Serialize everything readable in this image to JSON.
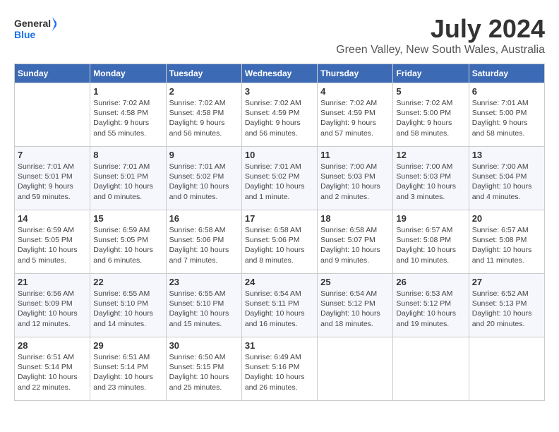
{
  "header": {
    "logo_line1": "General",
    "logo_line2": "Blue",
    "month_year": "July 2024",
    "location": "Green Valley, New South Wales, Australia"
  },
  "weekdays": [
    "Sunday",
    "Monday",
    "Tuesday",
    "Wednesday",
    "Thursday",
    "Friday",
    "Saturday"
  ],
  "weeks": [
    [
      {
        "day": "",
        "sunrise": "",
        "sunset": "",
        "daylight": ""
      },
      {
        "day": "1",
        "sunrise": "Sunrise: 7:02 AM",
        "sunset": "Sunset: 4:58 PM",
        "daylight": "Daylight: 9 hours and 55 minutes."
      },
      {
        "day": "2",
        "sunrise": "Sunrise: 7:02 AM",
        "sunset": "Sunset: 4:58 PM",
        "daylight": "Daylight: 9 hours and 56 minutes."
      },
      {
        "day": "3",
        "sunrise": "Sunrise: 7:02 AM",
        "sunset": "Sunset: 4:59 PM",
        "daylight": "Daylight: 9 hours and 56 minutes."
      },
      {
        "day": "4",
        "sunrise": "Sunrise: 7:02 AM",
        "sunset": "Sunset: 4:59 PM",
        "daylight": "Daylight: 9 hours and 57 minutes."
      },
      {
        "day": "5",
        "sunrise": "Sunrise: 7:02 AM",
        "sunset": "Sunset: 5:00 PM",
        "daylight": "Daylight: 9 hours and 58 minutes."
      },
      {
        "day": "6",
        "sunrise": "Sunrise: 7:01 AM",
        "sunset": "Sunset: 5:00 PM",
        "daylight": "Daylight: 9 hours and 58 minutes."
      }
    ],
    [
      {
        "day": "7",
        "sunrise": "Sunrise: 7:01 AM",
        "sunset": "Sunset: 5:01 PM",
        "daylight": "Daylight: 9 hours and 59 minutes."
      },
      {
        "day": "8",
        "sunrise": "Sunrise: 7:01 AM",
        "sunset": "Sunset: 5:01 PM",
        "daylight": "Daylight: 10 hours and 0 minutes."
      },
      {
        "day": "9",
        "sunrise": "Sunrise: 7:01 AM",
        "sunset": "Sunset: 5:02 PM",
        "daylight": "Daylight: 10 hours and 0 minutes."
      },
      {
        "day": "10",
        "sunrise": "Sunrise: 7:01 AM",
        "sunset": "Sunset: 5:02 PM",
        "daylight": "Daylight: 10 hours and 1 minute."
      },
      {
        "day": "11",
        "sunrise": "Sunrise: 7:00 AM",
        "sunset": "Sunset: 5:03 PM",
        "daylight": "Daylight: 10 hours and 2 minutes."
      },
      {
        "day": "12",
        "sunrise": "Sunrise: 7:00 AM",
        "sunset": "Sunset: 5:03 PM",
        "daylight": "Daylight: 10 hours and 3 minutes."
      },
      {
        "day": "13",
        "sunrise": "Sunrise: 7:00 AM",
        "sunset": "Sunset: 5:04 PM",
        "daylight": "Daylight: 10 hours and 4 minutes."
      }
    ],
    [
      {
        "day": "14",
        "sunrise": "Sunrise: 6:59 AM",
        "sunset": "Sunset: 5:05 PM",
        "daylight": "Daylight: 10 hours and 5 minutes."
      },
      {
        "day": "15",
        "sunrise": "Sunrise: 6:59 AM",
        "sunset": "Sunset: 5:05 PM",
        "daylight": "Daylight: 10 hours and 6 minutes."
      },
      {
        "day": "16",
        "sunrise": "Sunrise: 6:58 AM",
        "sunset": "Sunset: 5:06 PM",
        "daylight": "Daylight: 10 hours and 7 minutes."
      },
      {
        "day": "17",
        "sunrise": "Sunrise: 6:58 AM",
        "sunset": "Sunset: 5:06 PM",
        "daylight": "Daylight: 10 hours and 8 minutes."
      },
      {
        "day": "18",
        "sunrise": "Sunrise: 6:58 AM",
        "sunset": "Sunset: 5:07 PM",
        "daylight": "Daylight: 10 hours and 9 minutes."
      },
      {
        "day": "19",
        "sunrise": "Sunrise: 6:57 AM",
        "sunset": "Sunset: 5:08 PM",
        "daylight": "Daylight: 10 hours and 10 minutes."
      },
      {
        "day": "20",
        "sunrise": "Sunrise: 6:57 AM",
        "sunset": "Sunset: 5:08 PM",
        "daylight": "Daylight: 10 hours and 11 minutes."
      }
    ],
    [
      {
        "day": "21",
        "sunrise": "Sunrise: 6:56 AM",
        "sunset": "Sunset: 5:09 PM",
        "daylight": "Daylight: 10 hours and 12 minutes."
      },
      {
        "day": "22",
        "sunrise": "Sunrise: 6:55 AM",
        "sunset": "Sunset: 5:10 PM",
        "daylight": "Daylight: 10 hours and 14 minutes."
      },
      {
        "day": "23",
        "sunrise": "Sunrise: 6:55 AM",
        "sunset": "Sunset: 5:10 PM",
        "daylight": "Daylight: 10 hours and 15 minutes."
      },
      {
        "day": "24",
        "sunrise": "Sunrise: 6:54 AM",
        "sunset": "Sunset: 5:11 PM",
        "daylight": "Daylight: 10 hours and 16 minutes."
      },
      {
        "day": "25",
        "sunrise": "Sunrise: 6:54 AM",
        "sunset": "Sunset: 5:12 PM",
        "daylight": "Daylight: 10 hours and 18 minutes."
      },
      {
        "day": "26",
        "sunrise": "Sunrise: 6:53 AM",
        "sunset": "Sunset: 5:12 PM",
        "daylight": "Daylight: 10 hours and 19 minutes."
      },
      {
        "day": "27",
        "sunrise": "Sunrise: 6:52 AM",
        "sunset": "Sunset: 5:13 PM",
        "daylight": "Daylight: 10 hours and 20 minutes."
      }
    ],
    [
      {
        "day": "28",
        "sunrise": "Sunrise: 6:51 AM",
        "sunset": "Sunset: 5:14 PM",
        "daylight": "Daylight: 10 hours and 22 minutes."
      },
      {
        "day": "29",
        "sunrise": "Sunrise: 6:51 AM",
        "sunset": "Sunset: 5:14 PM",
        "daylight": "Daylight: 10 hours and 23 minutes."
      },
      {
        "day": "30",
        "sunrise": "Sunrise: 6:50 AM",
        "sunset": "Sunset: 5:15 PM",
        "daylight": "Daylight: 10 hours and 25 minutes."
      },
      {
        "day": "31",
        "sunrise": "Sunrise: 6:49 AM",
        "sunset": "Sunset: 5:16 PM",
        "daylight": "Daylight: 10 hours and 26 minutes."
      },
      {
        "day": "",
        "sunrise": "",
        "sunset": "",
        "daylight": ""
      },
      {
        "day": "",
        "sunrise": "",
        "sunset": "",
        "daylight": ""
      },
      {
        "day": "",
        "sunrise": "",
        "sunset": "",
        "daylight": ""
      }
    ]
  ]
}
